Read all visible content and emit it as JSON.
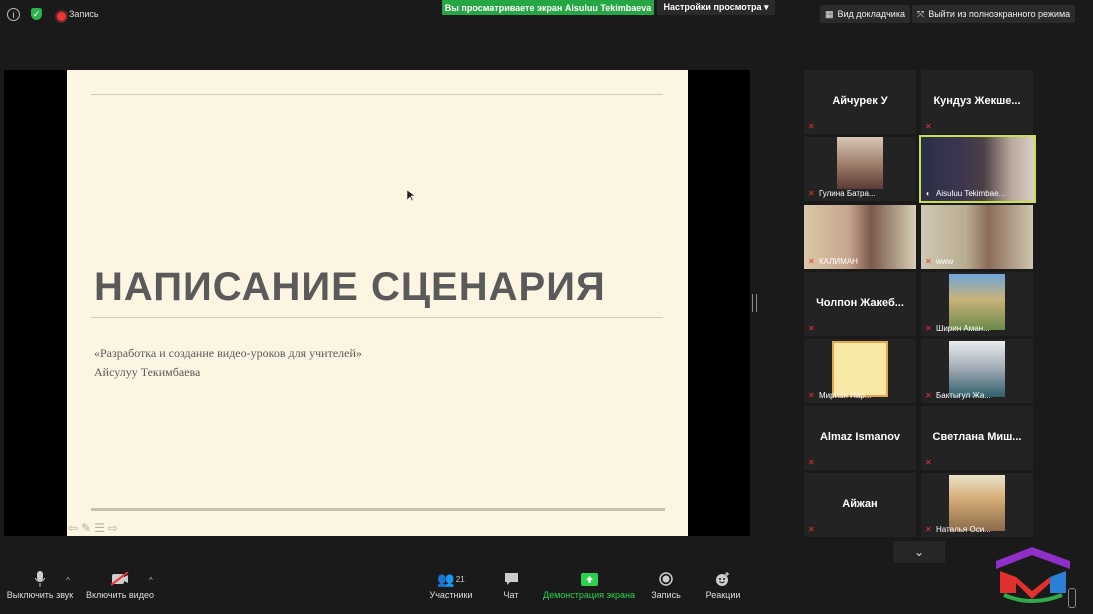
{
  "topbar": {
    "record_label": "Запись",
    "banner": "Вы просматриваете экран Aisuluu Tekimbaeva",
    "view_options": "Настройки просмотра ▾",
    "speaker_view": "Вид докладчика",
    "exit_fullscreen": "Выйти из полноэкранного режима"
  },
  "slide": {
    "title": "НАПИСАНИЕ СЦЕНАРИЯ",
    "subtitle": "«Разработка и создание видео-уроков для учителей»",
    "author": "Айсулуу Текимбаева"
  },
  "participants": [
    {
      "name": "Айчурек У",
      "label": ""
    },
    {
      "name": "Кундуз Жекше...",
      "label": ""
    },
    {
      "name": "",
      "label": "Гулина Батра..."
    },
    {
      "name": "",
      "label": "Aisuluu Tekimbae..."
    },
    {
      "name": "",
      "label": "КАЛИМАН"
    },
    {
      "name": "",
      "label": "www"
    },
    {
      "name": "Чолпон Жакеб...",
      "label": ""
    },
    {
      "name": "",
      "label": "Ширин Аман..."
    },
    {
      "name": "",
      "label": "Мириан Нар..."
    },
    {
      "name": "",
      "label": "Бактыгул Жа..."
    },
    {
      "name": "Almaz Ismanov",
      "label": ""
    },
    {
      "name": "Светлана Миш...",
      "label": ""
    },
    {
      "name": "Айжан",
      "label": ""
    },
    {
      "name": "",
      "label": "Наталья Оси..."
    }
  ],
  "toolbar": {
    "mute": "Выключить звук",
    "video": "Включить видео",
    "participants": "Участники",
    "participants_count": "21",
    "chat": "Чат",
    "share": "Демонстрация экрана",
    "record": "Запись",
    "reactions": "Реакции"
  },
  "colors": {
    "share_green": "#2bd24f",
    "active_speaker": "#c8e04a",
    "banner_green": "#26a644"
  }
}
